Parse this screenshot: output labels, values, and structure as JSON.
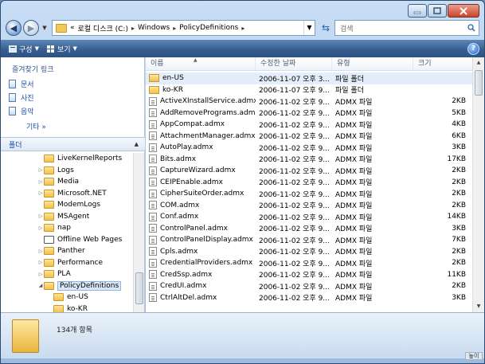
{
  "window": {
    "minimize": "minimize",
    "maximize": "maximize",
    "close": "close"
  },
  "address": {
    "crumbs": [
      "«",
      "로컬 디스크 (C:)",
      "Windows",
      "PolicyDefinitions"
    ],
    "search_placeholder": "검색"
  },
  "toolbar": {
    "organize": "구성",
    "views": "보기",
    "help": "?"
  },
  "left": {
    "fav_title": "즐겨찾기 링크",
    "favorites": [
      "문서",
      "사진",
      "음악"
    ],
    "more": "기타 »",
    "folders": "폴더",
    "tree": [
      "LiveKernelReports",
      "Logs",
      "Media",
      "Microsoft.NET",
      "ModemLogs",
      "MSAgent",
      "nap",
      "Offline Web Pages",
      "Panther",
      "Performance",
      "PLA",
      "PolicyDefinitions",
      "en-US",
      "ko-KR"
    ]
  },
  "list": {
    "headers": {
      "name": "이름",
      "date": "수정한 날짜",
      "type": "유형",
      "size": "크기"
    },
    "rows": [
      {
        "name": "en-US",
        "date": "2006-11-07 오후 3...",
        "type": "파일 폴더",
        "size": "",
        "kind": "folder"
      },
      {
        "name": "ko-KR",
        "date": "2006-11-07 오후 9...",
        "type": "파일 폴더",
        "size": "",
        "kind": "folder"
      },
      {
        "name": "ActiveXInstallService.admx",
        "date": "2006-11-02 오후 9...",
        "type": "ADMX 파일",
        "size": "2KB",
        "kind": "file"
      },
      {
        "name": "AddRemovePrograms.admx",
        "date": "2006-11-02 오후 9...",
        "type": "ADMX 파일",
        "size": "5KB",
        "kind": "file"
      },
      {
        "name": "AppCompat.admx",
        "date": "2006-11-02 오후 9...",
        "type": "ADMX 파일",
        "size": "4KB",
        "kind": "file"
      },
      {
        "name": "AttachmentManager.admx",
        "date": "2006-11-02 오후 9...",
        "type": "ADMX 파일",
        "size": "6KB",
        "kind": "file"
      },
      {
        "name": "AutoPlay.admx",
        "date": "2006-11-02 오후 9...",
        "type": "ADMX 파일",
        "size": "3KB",
        "kind": "file"
      },
      {
        "name": "Bits.admx",
        "date": "2006-11-02 오후 9...",
        "type": "ADMX 파일",
        "size": "17KB",
        "kind": "file"
      },
      {
        "name": "CaptureWizard.admx",
        "date": "2006-11-02 오후 9...",
        "type": "ADMX 파일",
        "size": "2KB",
        "kind": "file"
      },
      {
        "name": "CEIPEnable.admx",
        "date": "2006-11-02 오후 9...",
        "type": "ADMX 파일",
        "size": "2KB",
        "kind": "file"
      },
      {
        "name": "CipherSuiteOrder.admx",
        "date": "2006-11-02 오후 9...",
        "type": "ADMX 파일",
        "size": "2KB",
        "kind": "file"
      },
      {
        "name": "COM.admx",
        "date": "2006-11-02 오후 9...",
        "type": "ADMX 파일",
        "size": "2KB",
        "kind": "file"
      },
      {
        "name": "Conf.admx",
        "date": "2006-11-02 오후 9...",
        "type": "ADMX 파일",
        "size": "14KB",
        "kind": "file"
      },
      {
        "name": "ControlPanel.admx",
        "date": "2006-11-02 오후 9...",
        "type": "ADMX 파일",
        "size": "3KB",
        "kind": "file"
      },
      {
        "name": "ControlPanelDisplay.admx",
        "date": "2006-11-02 오후 9...",
        "type": "ADMX 파일",
        "size": "7KB",
        "kind": "file"
      },
      {
        "name": "Cpls.admx",
        "date": "2006-11-02 오후 9...",
        "type": "ADMX 파일",
        "size": "2KB",
        "kind": "file"
      },
      {
        "name": "CredentialProviders.admx",
        "date": "2006-11-02 오후 9...",
        "type": "ADMX 파일",
        "size": "2KB",
        "kind": "file"
      },
      {
        "name": "CredSsp.admx",
        "date": "2006-11-02 오후 9...",
        "type": "ADMX 파일",
        "size": "11KB",
        "kind": "file"
      },
      {
        "name": "CredUI.admx",
        "date": "2006-11-02 오후 9...",
        "type": "ADMX 파일",
        "size": "2KB",
        "kind": "file"
      },
      {
        "name": "CtrlAltDel.admx",
        "date": "2006-11-02 오후 9...",
        "type": "ADMX 파일",
        "size": "3KB",
        "kind": "file"
      }
    ]
  },
  "details": {
    "count": "134개 항목",
    "button": "높이"
  }
}
